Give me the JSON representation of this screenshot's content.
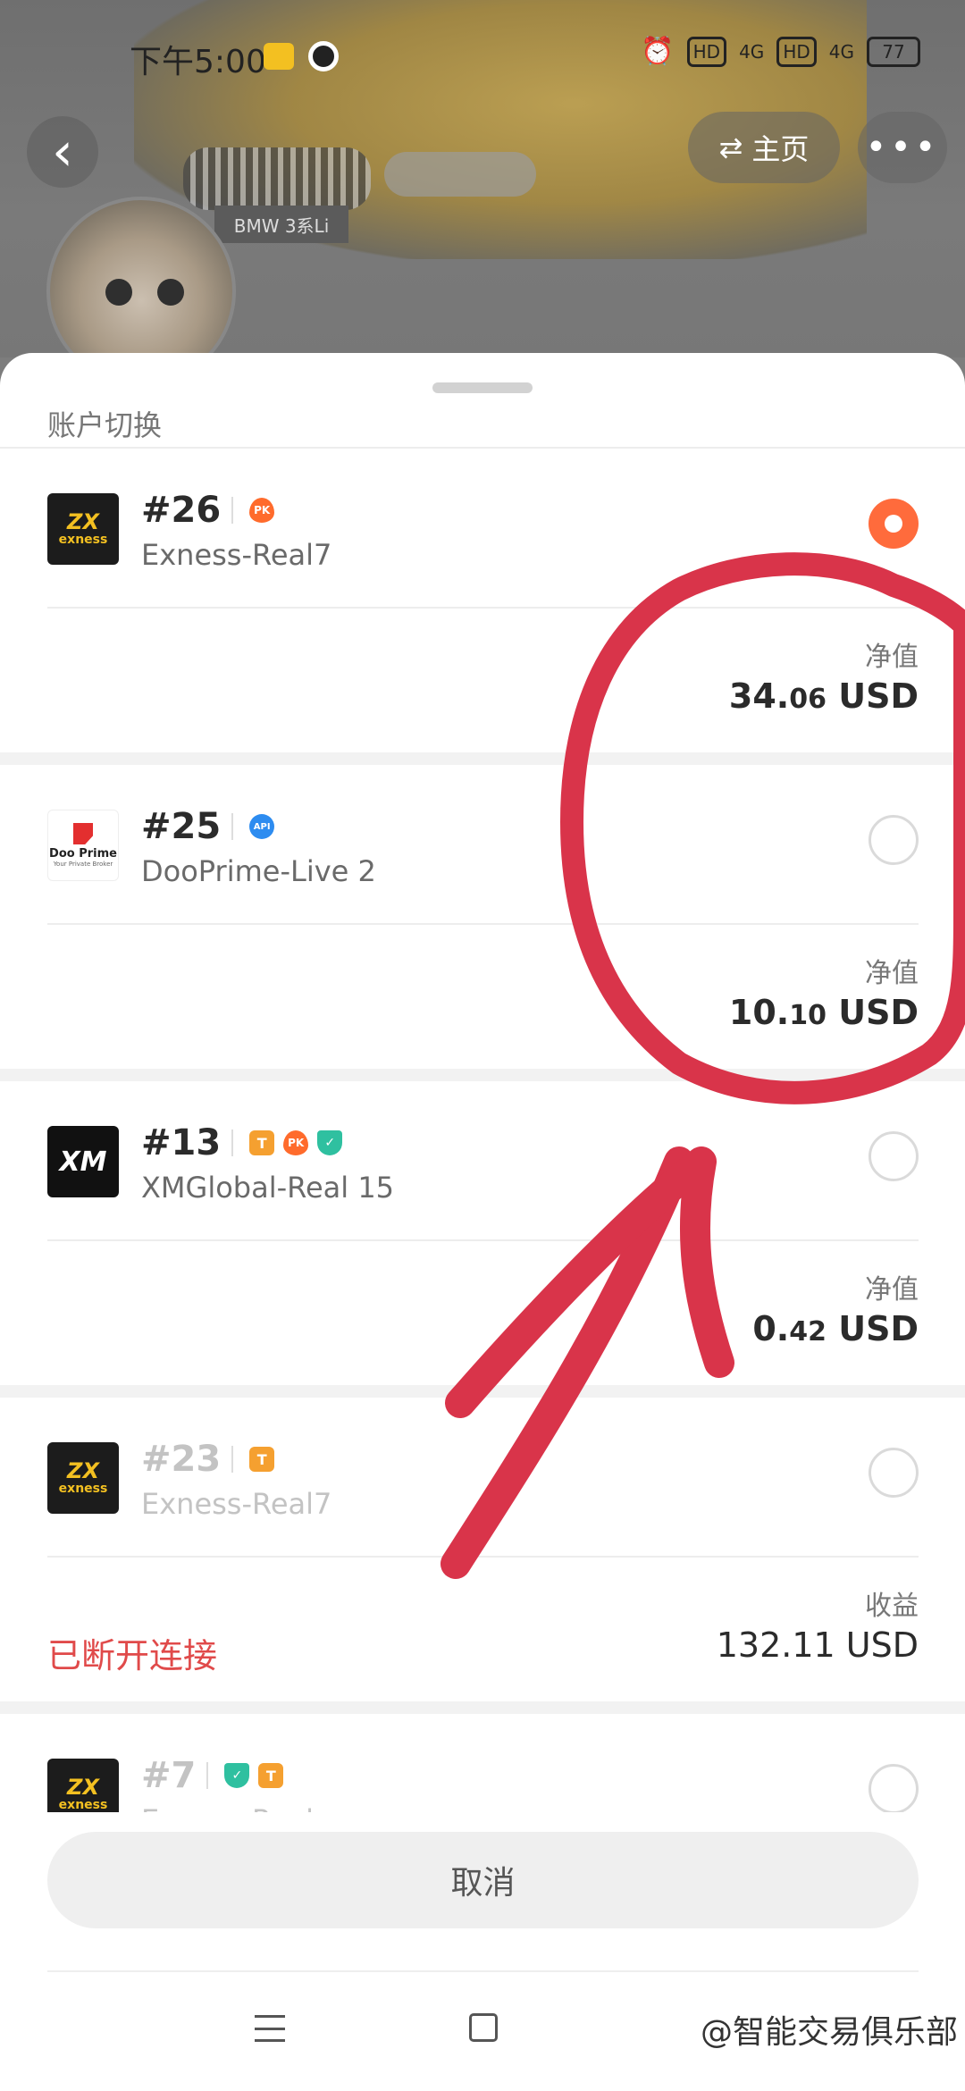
{
  "status_bar": {
    "time": "下午5:00",
    "indicators": [
      "HD",
      "4G",
      "HD",
      "4G"
    ],
    "battery": "77"
  },
  "header": {
    "back_icon": "chevron-left-icon",
    "switch_label": "主页",
    "switch_icon": "swap-icon",
    "more_icon": "more-dots-icon",
    "plate_text": "BMW 3系Li"
  },
  "sheet": {
    "title": "账户切换",
    "accounts": [
      {
        "number": "#26",
        "server": "Exness-Real7",
        "broker": "exness",
        "badges": [
          "PK"
        ],
        "selected": true,
        "value_label": "净值",
        "value_main": "34.",
        "value_cents": "06",
        "currency": " USD",
        "dimmed": false
      },
      {
        "number": "#25",
        "server": "DooPrime-Live 2",
        "broker": "dooprime",
        "badges": [
          "API"
        ],
        "selected": false,
        "value_label": "净值",
        "value_main": "10.",
        "value_cents": "10",
        "currency": " USD",
        "dimmed": false
      },
      {
        "number": "#13",
        "server": "XMGlobal-Real 15",
        "broker": "xm",
        "badges": [
          "T",
          "PK",
          "shield"
        ],
        "selected": false,
        "value_label": "净值",
        "value_main": "0.",
        "value_cents": "42",
        "currency": " USD",
        "dimmed": false
      },
      {
        "number": "#23",
        "server": "Exness-Real7",
        "broker": "exness",
        "badges": [
          "T"
        ],
        "selected": false,
        "value_label": "收益",
        "value_text": "132.11 USD",
        "status": "已断开连接",
        "dimmed": true
      },
      {
        "number": "#7",
        "server": "Exness-Real",
        "broker": "exness",
        "badges": [
          "shield",
          "T"
        ],
        "selected": false,
        "dimmed": true
      }
    ],
    "cancel_label": "取消"
  },
  "logos": {
    "exness_top": "ZX",
    "exness_text": "exness",
    "doo_text": "Doo Prime",
    "doo_sub": "Your Private Broker",
    "xm_text": "XM"
  },
  "badge_text": {
    "pk": "PK",
    "api": "API",
    "t": "T",
    "shield": "✓"
  },
  "watermark": "@智能交易俱乐部",
  "annotation_color": "#d9344a"
}
